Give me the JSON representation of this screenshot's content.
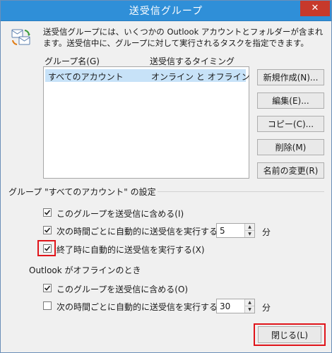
{
  "window": {
    "title": "送受信グループ",
    "close_glyph": "✕"
  },
  "description": "送受信グループには、いくつかの Outlook アカウントとフォルダーが含まれます。送受信中に、グループに対して実行されるタスクを指定できます。",
  "columns": {
    "name": "グループ名(G)",
    "timing": "送受信するタイミング"
  },
  "groups": [
    {
      "name": "すべてのアカウント",
      "timing": "オンライン と オフライン",
      "selected": true
    }
  ],
  "buttons": {
    "new": "新規作成(N)...",
    "edit": "編集(E)...",
    "copy": "コピー(C)...",
    "delete": "削除(M)",
    "rename": "名前の変更(R)",
    "close": "閉じる(L)"
  },
  "online_section": {
    "title": "グループ \"すべてのアカウント\" の設定",
    "include": {
      "label": "このグループを送受信に含める(I)",
      "checked": true
    },
    "schedule": {
      "label": "次の時間ごとに自動的に送受信を実行する(V)",
      "checked": true,
      "value": "5",
      "unit": "分"
    },
    "on_exit": {
      "label": "終了時に自動的に送受信を実行する(X)",
      "checked": true
    }
  },
  "offline_section": {
    "title": "Outlook がオフラインのとき",
    "include": {
      "label": "このグループを送受信に含める(O)",
      "checked": true
    },
    "schedule": {
      "label": "次の時間ごとに自動的に送受信を実行する(Y)",
      "checked": false,
      "value": "30",
      "unit": "分"
    }
  },
  "colors": {
    "titlebar": "#2f8fd8",
    "selection": "#c7e2f8",
    "highlight": "#e0141a",
    "close": "#c7392b"
  }
}
